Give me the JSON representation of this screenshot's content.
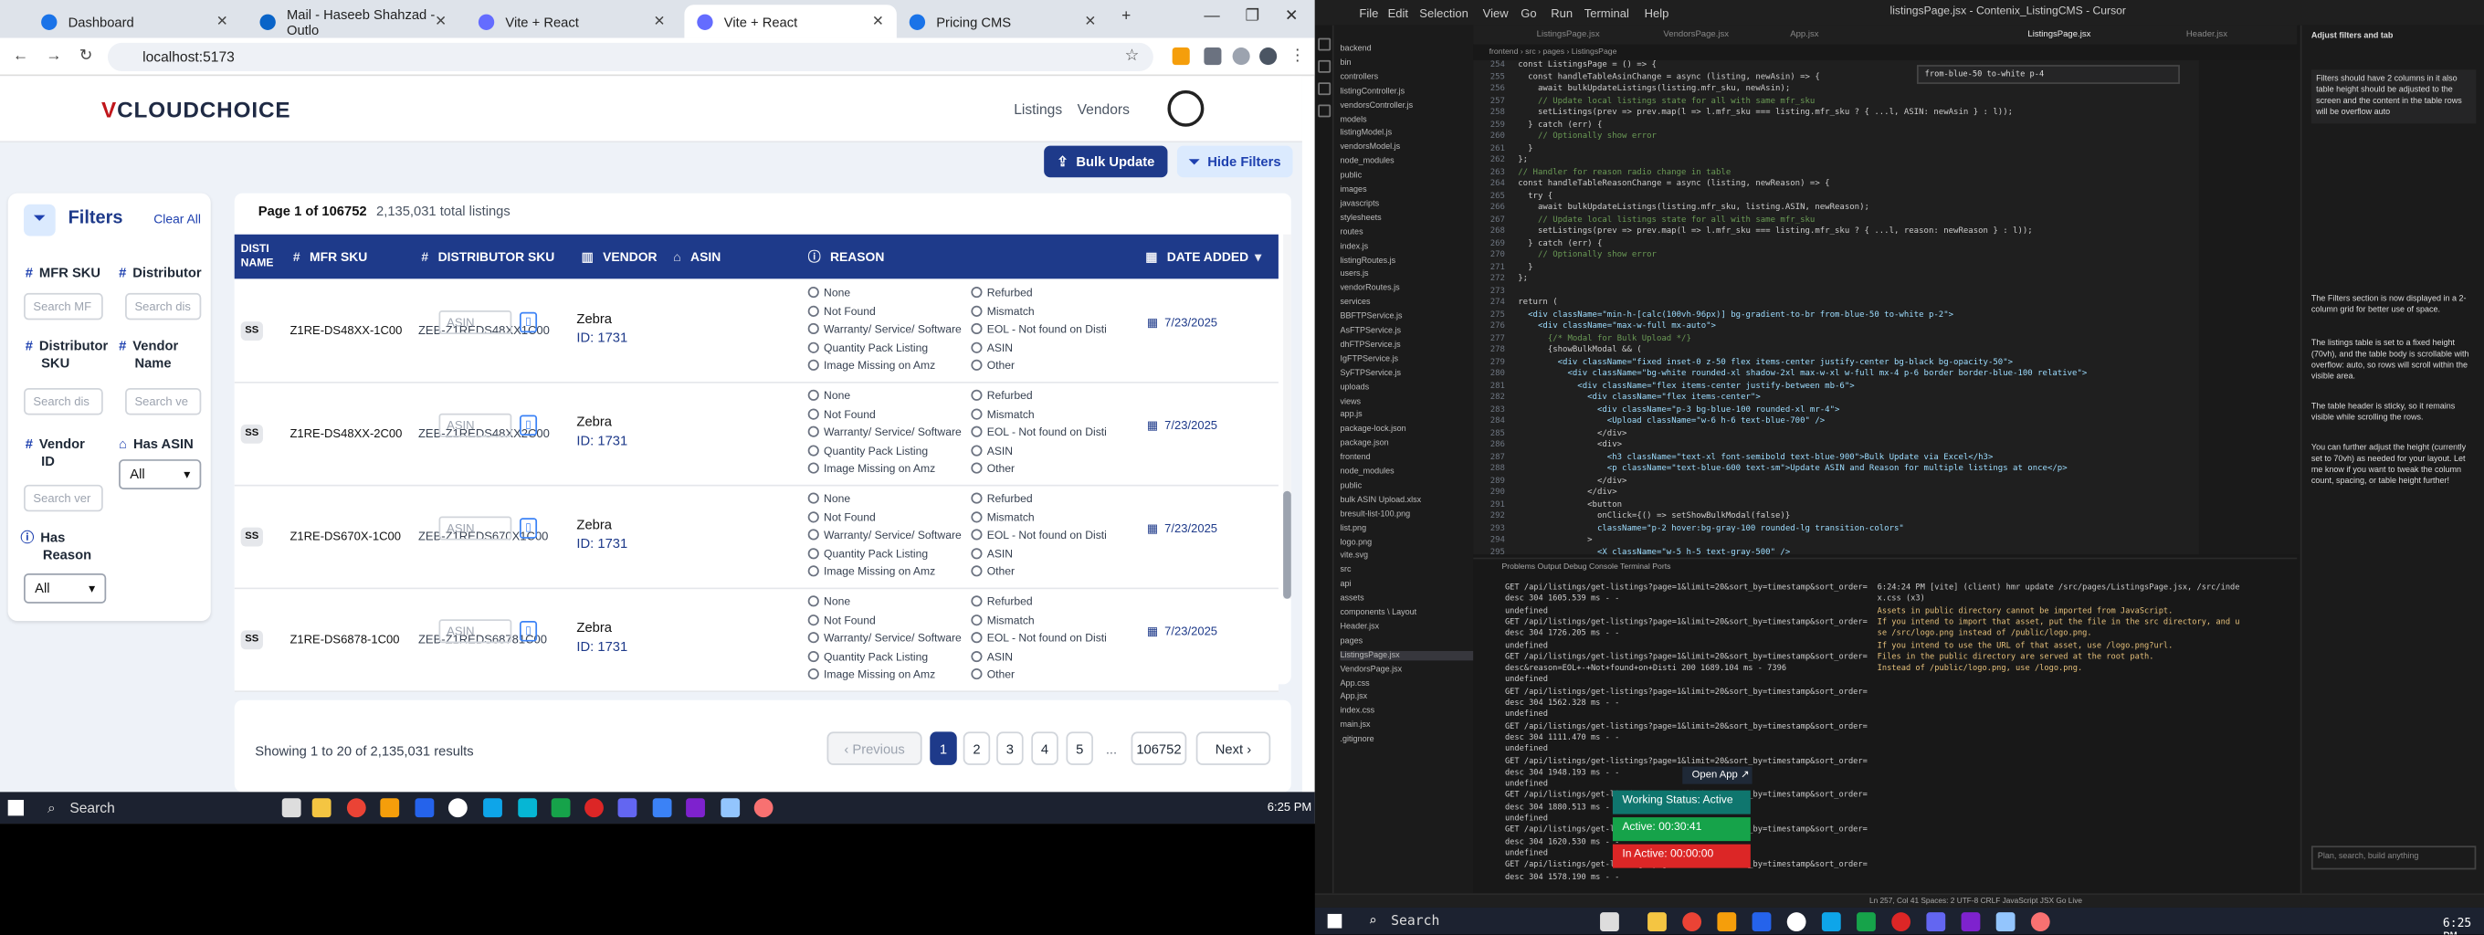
{
  "browser": {
    "tabs": [
      {
        "label": "Dashboard",
        "color": "#1a73e8"
      },
      {
        "label": "Mail - Haseeb Shahzad - Outlo",
        "color": "#0a64c8"
      },
      {
        "label": "Vite + React",
        "color": "#646cff"
      },
      {
        "label": "Vite + React",
        "color": "#646cff"
      },
      {
        "label": "Pricing CMS",
        "color": "#1a73e8"
      }
    ],
    "url": "localhost:5173"
  },
  "app": {
    "logo_mark": "V",
    "logo_text": "CLOUDCHOICE",
    "nav": [
      "Listings",
      "Vendors"
    ],
    "bulk_update": "Bulk Update",
    "hide_filters": "Hide Filters",
    "filters": {
      "title": "Filters",
      "clear_all": "Clear All",
      "mfr_sku": "MFR SKU",
      "mfr_sku_ph": "Search MF",
      "distributor": "Distributor",
      "distributor_ph": "Search dis",
      "distributor_sku_1": "Distributor",
      "distributor_sku_2": "SKU",
      "distributor_sku_ph": "Search dis",
      "vendor_name_1": "Vendor",
      "vendor_name_2": "Name",
      "vendor_name_ph": "Search ve",
      "vendor_id_1": "Vendor",
      "vendor_id_2": "ID",
      "vendor_id_ph": "Search ver",
      "has_asin": "Has ASIN",
      "has_asin_value": "All",
      "has_reason_1": "Has",
      "has_reason_2": "Reason",
      "has_reason_value": "All"
    },
    "page_info": "Page 1 of 106752",
    "total": "2,135,031 total listings",
    "columns": {
      "disti_1": "DISTI",
      "disti_2": "NAME",
      "mfr": "MFR SKU",
      "dist": "DISTRIBUTOR SKU",
      "vendor": "VENDOR",
      "asin": "ASIN",
      "reason": "REASON",
      "date": "DATE ADDED"
    },
    "reason_left": [
      "None",
      "Not Found",
      "Warranty/ Service/ Software",
      "Quantity Pack Listing",
      "Image Missing on Amz"
    ],
    "reason_right": [
      "Refurbed",
      "Mismatch",
      "EOL - Not found on Disti",
      "ASIN",
      "Other"
    ],
    "rows": [
      {
        "disti": "SS",
        "mfr": "Z1RE-DS48XX-1C00",
        "dist": "ZEB-Z1REDS48XX1C00",
        "vendor": "Zebra",
        "vendor_id": "ID: 1731",
        "asin_ph": "ASIN",
        "date": "7/23/2025"
      },
      {
        "disti": "SS",
        "mfr": "Z1RE-DS48XX-2C00",
        "dist": "ZEB-Z1REDS48XX2C00",
        "vendor": "Zebra",
        "vendor_id": "ID: 1731",
        "asin_ph": "ASIN",
        "date": "7/23/2025"
      },
      {
        "disti": "SS",
        "mfr": "Z1RE-DS670X-1C00",
        "dist": "ZEB-Z1REDS670X1C00",
        "vendor": "Zebra",
        "vendor_id": "ID: 1731",
        "asin_ph": "ASIN",
        "date": "7/23/2025"
      },
      {
        "disti": "SS",
        "mfr": "Z1RE-DS6878-1C00",
        "dist": "ZEB-Z1REDS68781C00",
        "vendor": "Zebra",
        "vendor_id": "ID: 1731",
        "asin_ph": "ASIN",
        "date": "7/23/2025"
      }
    ],
    "showing": "Showing 1 to 20 of 2,135,031 results",
    "pagination": {
      "prev": "‹ Previous",
      "pages": [
        "1",
        "2",
        "3",
        "4",
        "5"
      ],
      "dots": "...",
      "last": "106752",
      "next": "Next ›"
    }
  },
  "taskbar": {
    "search": "Search",
    "time": "6:25 PM"
  },
  "editor": {
    "menu": [
      "File",
      "Edit",
      "Selection",
      "View",
      "Go",
      "Run",
      "Terminal",
      "Help"
    ],
    "title": "listingsPage.jsx - Contenix_ListingCMS - Cursor",
    "tabs": [
      "ListingsPage.jsx",
      "VendorsPage.jsx",
      "App.jsx",
      "ListingsPage.jsx",
      "Header.jsx"
    ],
    "breadcrumb": "frontend › src › pages › ListingsPage",
    "find": "from-blue-50 to-white p-4",
    "explorer": [
      "backend",
      "bin",
      "controllers",
      "listingController.js",
      "vendorsController.js",
      "models",
      "listingModel.js",
      "vendorsModel.js",
      "node_modules",
      "public",
      "images",
      "javascripts",
      "stylesheets",
      "routes",
      "index.js",
      "listingRoutes.js",
      "users.js",
      "vendorRoutes.js",
      "services",
      "BBFTPService.js",
      "AsFTPService.js",
      "dhFTPService.js",
      "IgFTPService.js",
      "SyFTPService.js",
      "uploads",
      "views",
      "app.js",
      "package-lock.json",
      "package.json",
      "frontend",
      "node_modules",
      "public",
      "bulk ASIN Upload.xlsx",
      "bresult-list-100.png",
      "list.png",
      "logo.png",
      "vite.svg",
      "src",
      "api",
      "assets",
      "components \\ Layout",
      "Header.jsx",
      "pages",
      "ListingsPage.jsx",
      "VendorsPage.jsx",
      "App.css",
      "App.jsx",
      "index.css",
      "main.jsx",
      ".gitignore"
    ],
    "lines": [
      "254",
      "255",
      "256",
      "257",
      "258",
      "259",
      "260",
      "261",
      "262",
      "263",
      "264",
      "265",
      "266",
      "267",
      "268",
      "269",
      "270",
      "271",
      "272",
      "273",
      "274",
      "275",
      "276",
      "277",
      "278",
      "279",
      "280",
      "281",
      "282",
      "283",
      "284",
      "285",
      "286",
      "287",
      "288",
      "289",
      "290",
      "291",
      "292",
      "293",
      "294",
      "295"
    ],
    "code": [
      "  const ListingsPage = () => {",
      "    const handleTableAsinChange = async (listing, newAsin) => {",
      "      await bulkUpdateListings(listing.mfr_sku, newAsin);",
      "      // Update local listings state for all with same mfr_sku",
      "      setListings(prev => prev.map(l => l.mfr_sku === listing.mfr_sku ? { ...l, ASIN: newAsin } : l));",
      "    } catch (err) {",
      "      // Optionally show error",
      "    }",
      "  };",
      "  // Handler for reason radio change in table",
      "  const handleTableReasonChange = async (listing, newReason) => {",
      "    try {",
      "      await bulkUpdateListings(listing.mfr_sku, listing.ASIN, newReason);",
      "      // Update local listings state for all with same mfr_sku",
      "      setListings(prev => prev.map(l => l.mfr_sku === listing.mfr_sku ? { ...l, reason: newReason } : l));",
      "    } catch (err) {",
      "      // Optionally show error",
      "    }",
      "  };",
      "",
      "  return (",
      "    <div className=\"min-h-[calc(100vh-96px)] bg-gradient-to-br from-blue-50 to-white p-2\">",
      "      <div className=\"max-w-full mx-auto\">",
      "        {/* Modal for Bulk Upload */}",
      "        {showBulkModal && (",
      "          <div className=\"fixed inset-0 z-50 flex items-center justify-center bg-black bg-opacity-50\">",
      "            <div className=\"bg-white rounded-xl shadow-2xl max-w-xl w-full mx-4 p-6 border border-blue-100 relative\">",
      "              <div className=\"flex items-center justify-between mb-6\">",
      "                <div className=\"flex items-center\">",
      "                  <div className=\"p-3 bg-blue-100 rounded-xl mr-4\">",
      "                    <Upload className=\"w-6 h-6 text-blue-700\" />",
      "                  </div>",
      "                  <div>",
      "                    <h3 className=\"text-xl font-semibold text-blue-900\">Bulk Update via Excel</h3>",
      "                    <p className=\"text-blue-600 text-sm\">Update ASIN and Reason for multiple listings at once</p>",
      "                  </div>",
      "                </div>",
      "                <button",
      "                  onClick={() => setShowBulkModal(false)}",
      "                  className=\"p-2 hover:bg-gray-100 rounded-lg transition-colors\"",
      "                >",
      "                  <X className=\"w-5 h-5 text-gray-500\" />"
    ],
    "panel_tabs": "Problems   Output   Debug Console   Terminal   Ports",
    "term_left": [
      "GET /api/listings/get-listings?page=1&limit=20&sort_by=timestamp&sort_order=",
      "desc 304 1605.539 ms - -",
      "undefined",
      "GET /api/listings/get-listings?page=1&limit=20&sort_by=timestamp&sort_order=",
      "desc 304 1726.205 ms - -",
      "undefined",
      "GET /api/listings/get-listings?page=1&limit=20&sort_by=timestamp&sort_order=",
      "desc&reason=EOL+-+Not+found+on+Disti 200 1689.104 ms - 7396",
      "undefined",
      "GET /api/listings/get-listings?page=1&limit=20&sort_by=timestamp&sort_order=",
      "desc 304 1562.328 ms - -",
      "undefined",
      "GET /api/listings/get-listings?page=1&limit=20&sort_by=timestamp&sort_order=",
      "desc 304 1111.470 ms - -",
      "undefined",
      "GET /api/listings/get-listings?page=1&limit=20&sort_by=timestamp&sort_order=",
      "desc 304 1948.193 ms - -",
      "undefined",
      "GET /api/listings/get-listings?page=1&limit=20&sort_by=timestamp&sort_order=",
      "desc 304 1880.513 ms - -",
      "undefined",
      "GET /api/listings/get-listings?page=1&limit=20&sort_by=timestamp&sort_order=",
      "desc 304 1620.530 ms - -",
      "undefined",
      "GET /api/listings/get-listings?page=1&limit=20&sort_by=timestamp&sort_order=",
      "desc 304 1578.190 ms - -"
    ],
    "term_right": [
      "6:24:24 PM [vite] (client) hmr update /src/pages/ListingsPage.jsx, /src/inde",
      "x.css (x3)",
      "Assets in public directory cannot be imported from JavaScript.",
      "If you intend to import that asset, put the file in the src directory, and u",
      "se /src/logo.png instead of /public/logo.png.",
      "If you intend to use the URL of that asset, use /logo.png?url.",
      "Files in the public directory are served at the root path.",
      "Instead of /public/logo.png, use /logo.png."
    ],
    "widget": {
      "open": "Open App ↗",
      "status": "Working Status: Active",
      "active": "Active: 00:30:41",
      "inactive": "In Active: 00:00:00"
    },
    "chat": {
      "title": "Adjust filters and tab",
      "user_msg": "Filters should have 2 columns in it also table height should be adjusted to the screen and the content in the table rows will be overflow auto",
      "points": [
        "The Filters section is now displayed in a 2-column grid for better use of space.",
        "The listings table is set to a fixed height (70vh), and the table body is scrollable with overflow: auto, so rows will scroll within the visible area.",
        "The table header is sticky, so it remains visible while scrolling the rows.",
        "You can further adjust the height (currently set to 70vh) as needed for your layout. Let me know if you want to tweak the column count, spacing, or table height further!"
      ],
      "input": "Plan, search, build anything"
    },
    "statusbar": "Ln 257, Col 41   Spaces: 2   UTF-8   CRLF   JavaScript JSX   Go Live"
  },
  "colors": {
    "primary": "#1e3a8a",
    "accent": "#dbeafe",
    "logo_red": "#c0161b",
    "widget_green": "#16a34a",
    "widget_teal": "#0f766e",
    "widget_red": "#dc2626"
  }
}
